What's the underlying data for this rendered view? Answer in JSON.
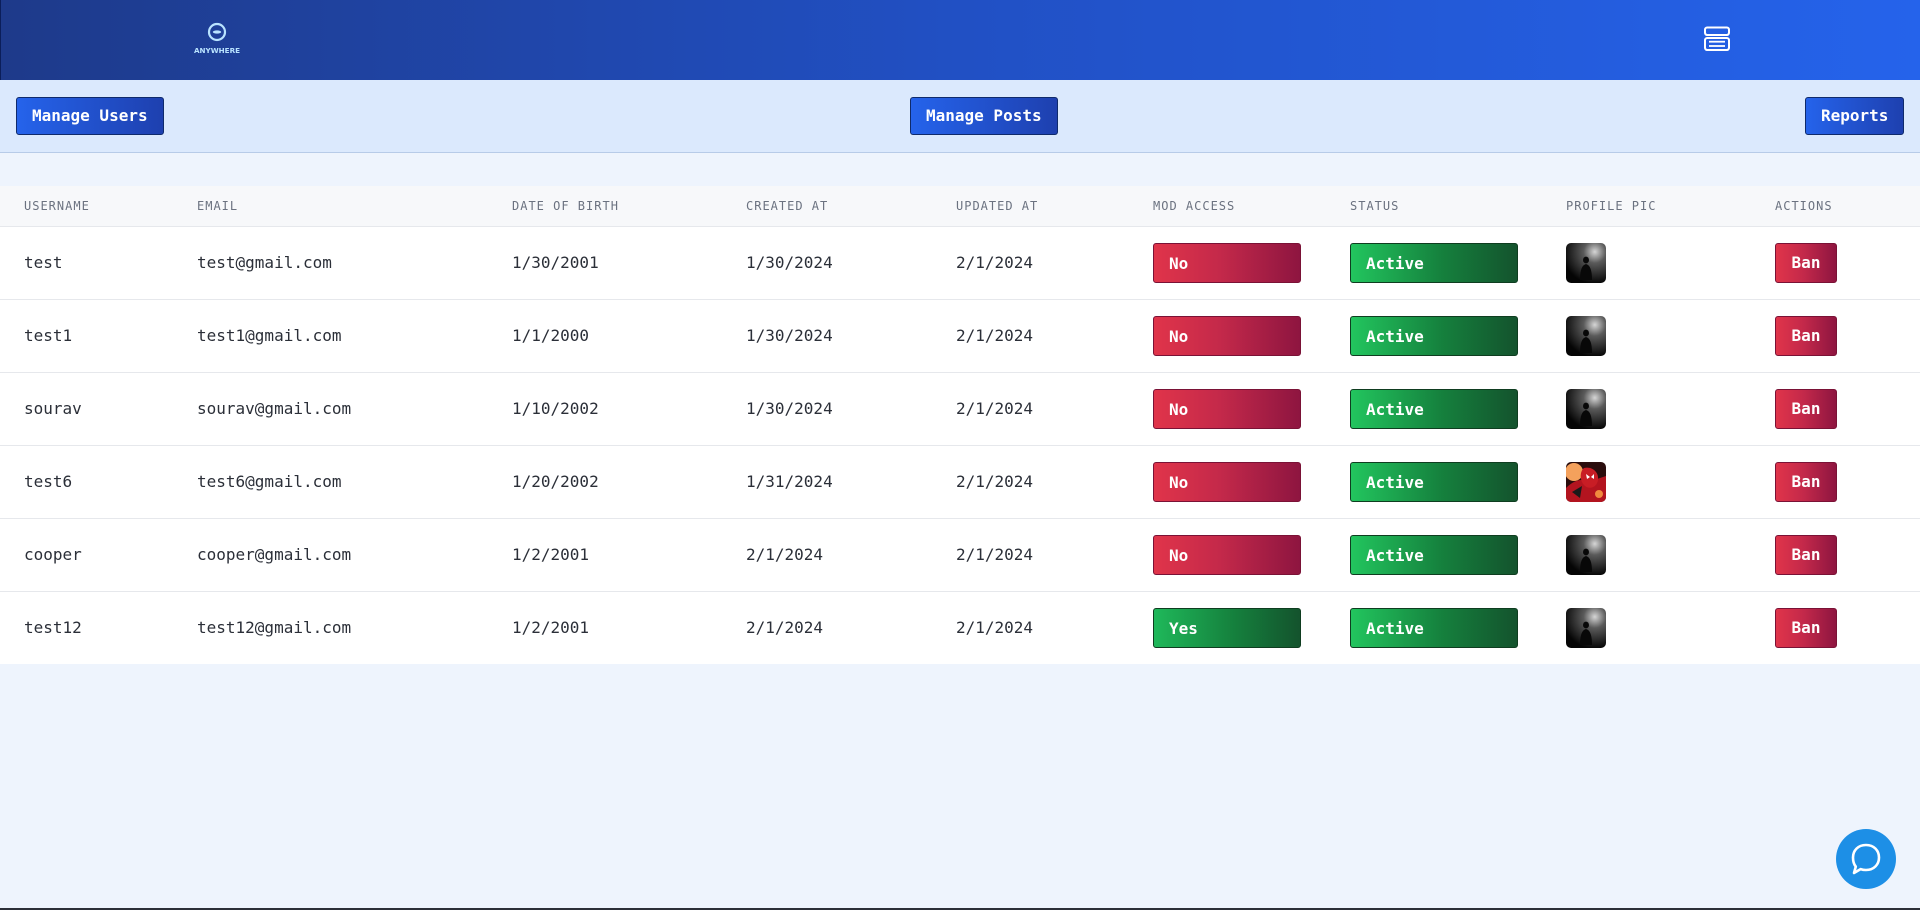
{
  "header": {
    "logo_text": "ANYWHERE",
    "logo_icon": "globe-icon",
    "menu_icon": "server-menu-icon"
  },
  "toolbar": {
    "manage_users": "Manage Users",
    "manage_posts": "Manage Posts",
    "reports": "Reports"
  },
  "table": {
    "columns": [
      "USERNAME",
      "EMAIL",
      "DATE OF BIRTH",
      "CREATED AT",
      "UPDATED AT",
      "MOD ACCESS",
      "STATUS",
      "PROFILE PIC",
      "ACTIONS"
    ],
    "rows": [
      {
        "username": "test",
        "email": "test@gmail.com",
        "dob": "1/30/2001",
        "created": "1/30/2024",
        "updated": "2/1/2024",
        "mod": "No",
        "status": "Active",
        "pic": "dark-figure-avatar",
        "action": "Ban"
      },
      {
        "username": "test1",
        "email": "test1@gmail.com",
        "dob": "1/1/2000",
        "created": "1/30/2024",
        "updated": "2/1/2024",
        "mod": "No",
        "status": "Active",
        "pic": "dark-figure-avatar",
        "action": "Ban"
      },
      {
        "username": "sourav",
        "email": "sourav@gmail.com",
        "dob": "1/10/2002",
        "created": "1/30/2024",
        "updated": "2/1/2024",
        "mod": "No",
        "status": "Active",
        "pic": "dark-figure-avatar",
        "action": "Ban"
      },
      {
        "username": "test6",
        "email": "test6@gmail.com",
        "dob": "1/20/2002",
        "created": "1/31/2024",
        "updated": "2/1/2024",
        "mod": "No",
        "status": "Active",
        "pic": "spiderman-avatar",
        "action": "Ban"
      },
      {
        "username": "cooper",
        "email": "cooper@gmail.com",
        "dob": "1/2/2001",
        "created": "2/1/2024",
        "updated": "2/1/2024",
        "mod": "No",
        "status": "Active",
        "pic": "dark-figure-avatar",
        "action": "Ban"
      },
      {
        "username": "test12",
        "email": "test12@gmail.com",
        "dob": "1/2/2001",
        "created": "2/1/2024",
        "updated": "2/1/2024",
        "mod": "Yes",
        "status": "Active",
        "pic": "dark-figure-avatar",
        "action": "Ban"
      }
    ]
  },
  "chat": {
    "icon": "chat-bubble-icon"
  },
  "colors": {
    "header_start": "#1e3a8a",
    "header_end": "#2563eb",
    "no_red": "#e0344a",
    "yes_green": "#1fb85a",
    "active_green": "#22c55e",
    "chat_blue": "#1d8fe6"
  }
}
